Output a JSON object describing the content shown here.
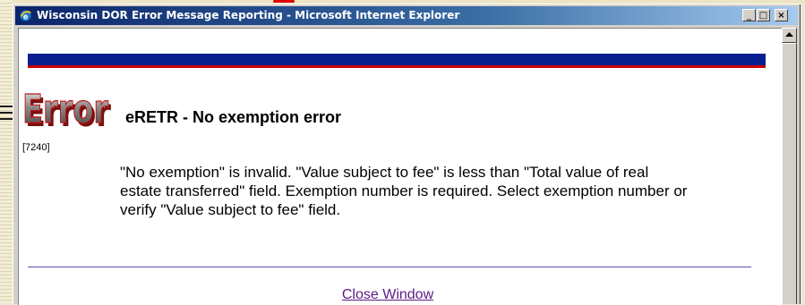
{
  "window": {
    "title": "Wisconsin DOR Error Message Reporting - Microsoft Internet Explorer",
    "icon": "ie-icon",
    "controls": {
      "minimize": "_",
      "maximize": "□",
      "close": "×"
    }
  },
  "error": {
    "logo_text": "Error",
    "title": "eRETR - No exemption error",
    "code": "[7240]",
    "message": "\"No exemption\" is invalid.  \"Value subject to fee\" is less than \"Total value of real estate transferred\" field.  Exemption number is required.  Select exemption number or verify \"Value subject to fee\" field."
  },
  "footer": {
    "close_label": "Close Window"
  },
  "colors": {
    "title_bar_start": "#0a246a",
    "title_bar_end": "#a6caf0",
    "header_bar_blue": "#0a1f8f",
    "header_bar_red": "#cc0000",
    "link": "#5c1a86",
    "divider": "#5a4fb4"
  }
}
